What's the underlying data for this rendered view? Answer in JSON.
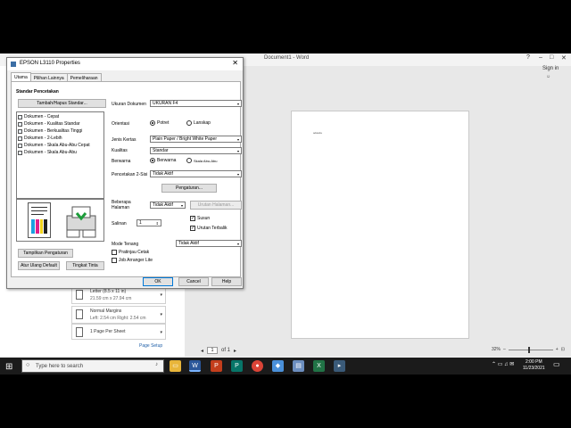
{
  "word": {
    "title": "Document1 - Word",
    "sign_in": "Sign in",
    "preview_text": "adasda",
    "page_nav": {
      "current": "1",
      "of_label": "of 1"
    },
    "zoom": "32%",
    "paper_size": {
      "title": "Letter (8.5 x 11 in)",
      "subtitle": "21.59 cm x 27.94 cm"
    },
    "margins": {
      "title": "Normal Margins",
      "subtitle": "Left: 2.54 cm   Right: 2.54 cm"
    },
    "pages_per_sheet": {
      "title": "1 Page Per Sheet"
    },
    "page_setup_link": "Page Setup"
  },
  "dialog": {
    "title": "EPSON L3110 Properties",
    "tabs": [
      "Utama",
      "Pilihan Lainnya",
      "Pemeliharaan"
    ],
    "section_title": "Standar Pencetakan",
    "add_remove_button": "Tambah/Hapus Standar...",
    "presets": [
      "Dokumen - Cepat",
      "Dokumen - Kualitas Standar",
      "Dokumen - Berkualitas Tinggi",
      "Dokumen - 2-Lebih",
      "Dokumen - Skala Abu-Abu Cepat",
      "Dokumen - Skala Abu-Abu"
    ],
    "show_settings_button": "Tampilkan Pengaturan",
    "reset_button": "Atur Ulang Default",
    "ink_level_button": "Tingkat Tinta",
    "doc_size": {
      "label": "Ukuran Dokumen",
      "value": "UKURAN F4"
    },
    "orientation": {
      "label": "Orientasi",
      "options": [
        "Potret",
        "Lanskap"
      ],
      "selected": "Potret"
    },
    "paper_type": {
      "label": "Jenis Kertas",
      "value": "Plain Paper / Bright White Paper"
    },
    "quality": {
      "label": "Kualitas",
      "value": "Standar"
    },
    "color": {
      "label": "Berwarna",
      "options": [
        "Berwarna",
        "Skala Abu-Abu"
      ],
      "selected": "Berwarna"
    },
    "duplex": {
      "label": "Pencetakan 2-Sisi",
      "value": "Tidak Aktif",
      "settings_button": "Pengaturan..."
    },
    "multipage": {
      "label1": "Beberapa",
      "label2": "Halaman",
      "value": "Tidak Aktif",
      "order_button": "Urutan Halaman..."
    },
    "copies": {
      "label": "Salinan",
      "value": "1"
    },
    "collate": {
      "label": "Susun",
      "checked": true
    },
    "reverse_order": {
      "label": "Urutan Terbalik",
      "checked": true
    },
    "quiet_mode": {
      "label": "Mode Tenang",
      "value": "Tidak Aktif"
    },
    "print_preview": {
      "label": "Pratinjau Cetak",
      "checked": false
    },
    "job_arranger": {
      "label": "Job Arranger Lite",
      "checked": false
    },
    "ok_button": "OK",
    "cancel_button": "Cancel",
    "help_button": "Help"
  },
  "taskbar": {
    "search_placeholder": "Type here to search",
    "time": "2:00 PM",
    "date": "11/23/2021",
    "apps": [
      "file-explorer",
      "word",
      "powerpoint",
      "publisher",
      "chrome",
      "app-blue",
      "app-printer",
      "excel",
      "app-terminal"
    ]
  },
  "colors": {
    "word_blue": "#2b579a",
    "taskbar": "#1b1b1b",
    "link_blue": "#1f5fa8"
  }
}
